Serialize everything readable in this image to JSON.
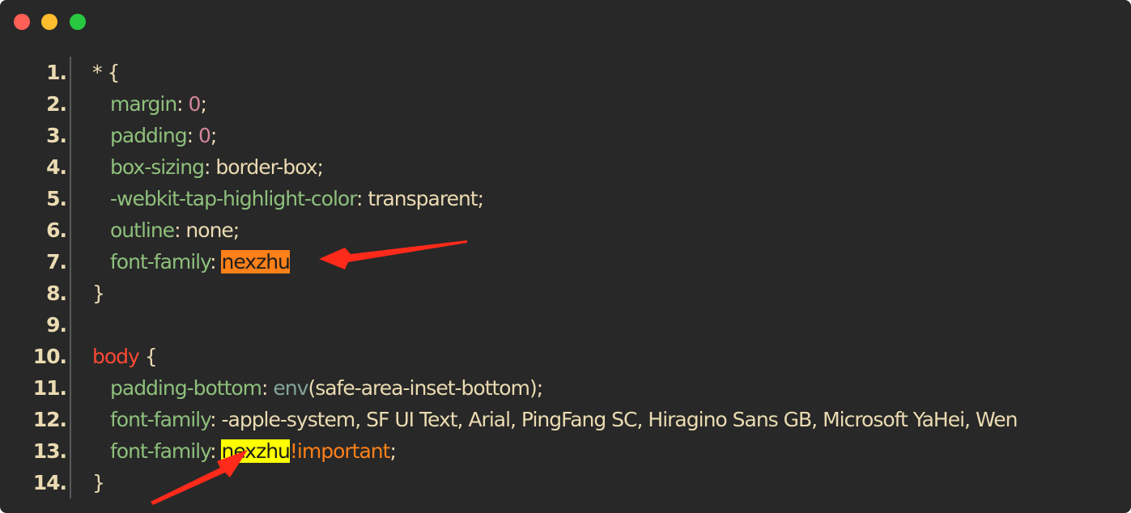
{
  "window": {
    "controls": {
      "close_color": "#fe5f57",
      "minimize_color": "#febc2e",
      "zoom_color": "#28c840"
    }
  },
  "editor": {
    "lines": [
      {
        "n": "1.",
        "tokens": [
          {
            "t": "* {",
            "c": "text"
          }
        ]
      },
      {
        "n": "2.",
        "indent": true,
        "tokens": [
          {
            "t": "margin",
            "c": "prop"
          },
          {
            "t": ": ",
            "c": "text"
          },
          {
            "t": "0",
            "c": "num"
          },
          {
            "t": ";",
            "c": "text"
          }
        ]
      },
      {
        "n": "3.",
        "indent": true,
        "tokens": [
          {
            "t": "padding",
            "c": "prop"
          },
          {
            "t": ": ",
            "c": "text"
          },
          {
            "t": "0",
            "c": "num"
          },
          {
            "t": ";",
            "c": "text"
          }
        ]
      },
      {
        "n": "4.",
        "indent": true,
        "tokens": [
          {
            "t": "box-sizing",
            "c": "prop"
          },
          {
            "t": ": border-box;",
            "c": "text"
          }
        ]
      },
      {
        "n": "5.",
        "indent": true,
        "tokens": [
          {
            "t": "-webkit-tap-highlight-color",
            "c": "prop"
          },
          {
            "t": ": transparent;",
            "c": "text"
          }
        ]
      },
      {
        "n": "6.",
        "indent": true,
        "tokens": [
          {
            "t": "outline",
            "c": "prop"
          },
          {
            "t": ": none;",
            "c": "text"
          }
        ]
      },
      {
        "n": "7.",
        "indent": true,
        "tokens": [
          {
            "t": "font-family",
            "c": "prop"
          },
          {
            "t": ": ",
            "c": "text"
          },
          {
            "t": "nexzhu",
            "c": "hl-orange"
          }
        ]
      },
      {
        "n": "8.",
        "tokens": [
          {
            "t": "}",
            "c": "text"
          }
        ]
      },
      {
        "n": "9.",
        "tokens": []
      },
      {
        "n": "10.",
        "tokens": [
          {
            "t": "body",
            "c": "sel"
          },
          {
            "t": " {",
            "c": "text"
          }
        ]
      },
      {
        "n": "11.",
        "indent": true,
        "tokens": [
          {
            "t": "padding-bottom",
            "c": "prop"
          },
          {
            "t": ": ",
            "c": "text"
          },
          {
            "t": "env",
            "c": "fn"
          },
          {
            "t": "(safe-area-inset-bottom);",
            "c": "text"
          }
        ]
      },
      {
        "n": "12.",
        "indent": true,
        "tokens": [
          {
            "t": "font-family",
            "c": "prop"
          },
          {
            "t": ": -apple-system, SF UI Text, Arial, PingFang SC, Hiragino Sans GB, Microsoft YaHei, Wen",
            "c": "text"
          }
        ]
      },
      {
        "n": "13.",
        "indent": true,
        "tokens": [
          {
            "t": "font-family",
            "c": "prop"
          },
          {
            "t": ": ",
            "c": "text"
          },
          {
            "t": "nexzhu",
            "c": "hl-yellow"
          },
          {
            "t": "!important",
            "c": "imp"
          },
          {
            "t": ";",
            "c": "text"
          }
        ]
      },
      {
        "n": "14.",
        "tokens": [
          {
            "t": "}",
            "c": "text"
          }
        ]
      }
    ]
  },
  "annotations": {
    "arrow_color": "#ff2a1a"
  }
}
